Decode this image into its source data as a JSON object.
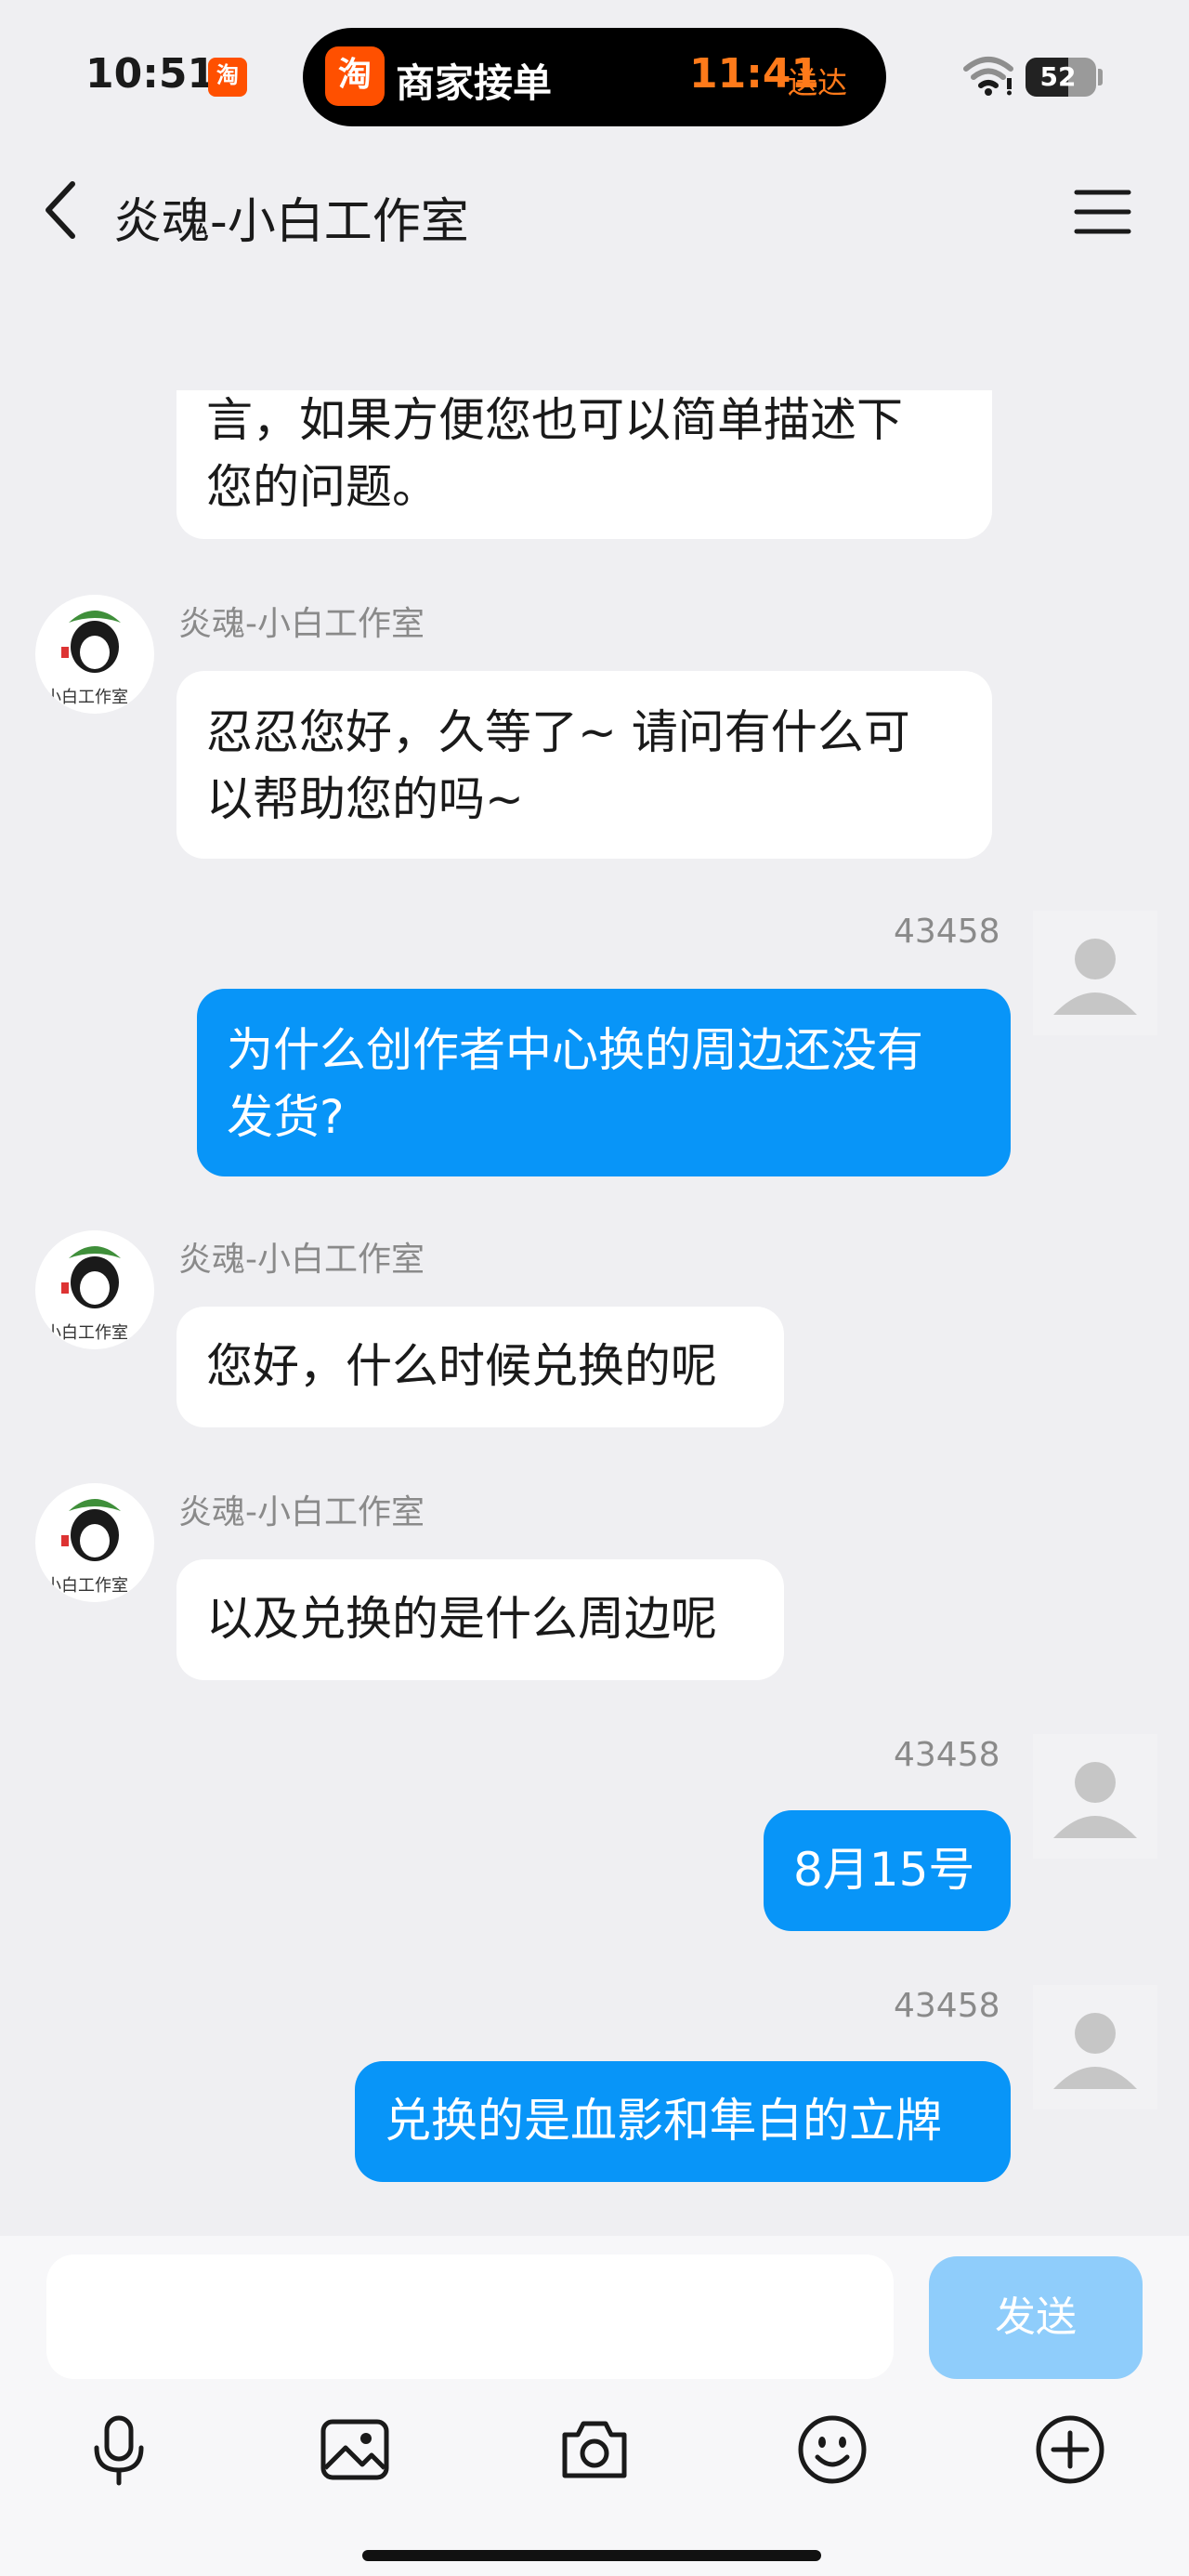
{
  "status_bar": {
    "time": "10:51",
    "taobao_icon": "淘",
    "island": {
      "app_icon": "淘",
      "title": "商家接单",
      "time": "11:41",
      "suffix": "送达"
    },
    "battery_level": "52",
    "icons": [
      "wifi-icon",
      "battery-icon"
    ]
  },
  "nav": {
    "title": "炎魂-小白工作室",
    "icons": [
      "back-icon",
      "menu-icon"
    ]
  },
  "chat": {
    "shop_name": "炎魂-小白工作室",
    "user_name": "43458",
    "avatar_text": "小白工作室",
    "messages": [
      {
        "from": "shop",
        "text_lines": [
          "言，如果方便您也可以简单描述下",
          "您的问题。"
        ]
      },
      {
        "from": "shop",
        "name": "炎魂-小白工作室",
        "text_lines": [
          "忍忍您好，久等了~ 请问有什么可",
          "以帮助您的吗~"
        ]
      },
      {
        "from": "user",
        "name": "43458",
        "text_lines": [
          "为什么创作者中心换的周边还没有",
          "发货?"
        ]
      },
      {
        "from": "shop",
        "name": "炎魂-小白工作室",
        "text_lines": [
          "您好，什么时候兑换的呢"
        ]
      },
      {
        "from": "shop",
        "name": "炎魂-小白工作室",
        "text_lines": [
          "以及兑换的是什么周边呢"
        ]
      },
      {
        "from": "user",
        "name": "43458",
        "text_lines": [
          "8月15号"
        ]
      },
      {
        "from": "user",
        "name": "43458",
        "text_lines": [
          "兑换的是血影和隼白的立牌"
        ]
      }
    ]
  },
  "input": {
    "value": "",
    "send_label": "发送",
    "tools": [
      "microphone-icon",
      "image-icon",
      "camera-icon",
      "emoji-icon",
      "plus-icon"
    ]
  },
  "colors": {
    "background": "#efeff2",
    "outgoing_bubble": "#0895f8",
    "incoming_bubble": "#ffffff",
    "send_button": "#8fcdfb",
    "brand_orange": "#ff5000"
  }
}
